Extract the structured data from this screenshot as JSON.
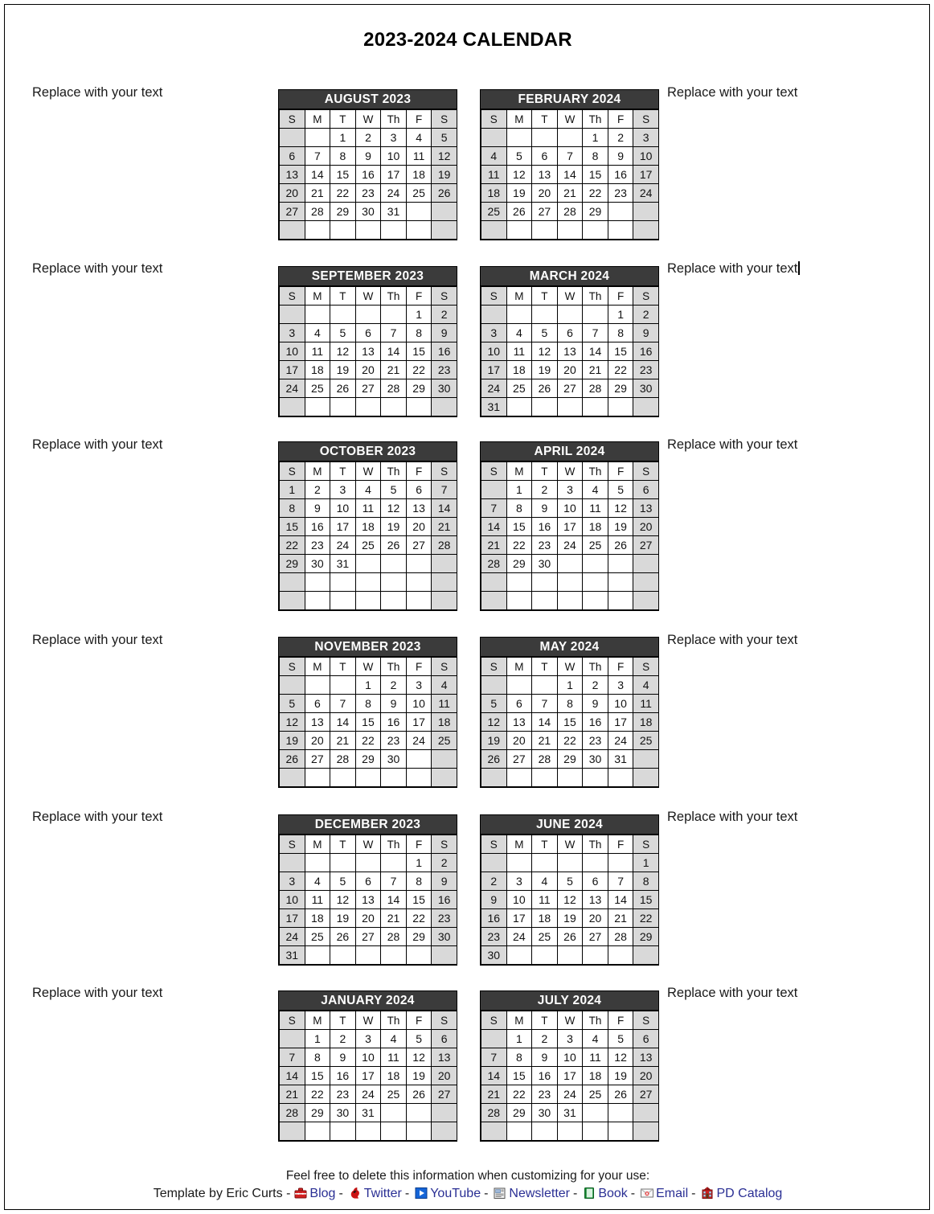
{
  "document": {
    "title": "2023-2024 CALENDAR"
  },
  "side_labels": {
    "default": "Replace with your text",
    "rows": [
      {
        "left": "Replace with your text",
        "right": "Replace with your text",
        "right_caret": false
      },
      {
        "left": "Replace with your text",
        "right": "Replace with your text",
        "right_caret": true
      },
      {
        "left": "Replace with your text",
        "right": "Replace with your text",
        "right_caret": false
      },
      {
        "left": "Replace with your text",
        "right": "Replace with your text",
        "right_caret": false
      },
      {
        "left": "Replace with your text",
        "right": "Replace with your text",
        "right_caret": false
      },
      {
        "left": "Replace with your text",
        "right": "Replace with your text",
        "right_caret": false
      }
    ]
  },
  "weekday_headers": [
    "S",
    "M",
    "T",
    "W",
    "Th",
    "F",
    "S"
  ],
  "colors": {
    "month_header_bg": "#3b3b3b",
    "month_header_text": "#ffffff",
    "weekend_cell_bg": "#d9d9d9",
    "cell_bg": "#ffffff",
    "grid_line": "#000000",
    "link": "#2a2f94",
    "page_border": "#000000"
  },
  "months": [
    {
      "name": "AUGUST 2023",
      "column": "left",
      "row": 0,
      "weeks": [
        [
          "",
          "",
          "1",
          "2",
          "3",
          "4",
          "5"
        ],
        [
          "6",
          "7",
          "8",
          "9",
          "10",
          "11",
          "12"
        ],
        [
          "13",
          "14",
          "15",
          "16",
          "17",
          "18",
          "19"
        ],
        [
          "20",
          "21",
          "22",
          "23",
          "24",
          "25",
          "26"
        ],
        [
          "27",
          "28",
          "29",
          "30",
          "31",
          "",
          ""
        ],
        [
          "",
          "",
          "",
          "",
          "",
          "",
          ""
        ]
      ]
    },
    {
      "name": "FEBRUARY 2024",
      "column": "right",
      "row": 0,
      "weeks": [
        [
          "",
          "",
          "",
          "",
          "1",
          "2",
          "3"
        ],
        [
          "4",
          "5",
          "6",
          "7",
          "8",
          "9",
          "10"
        ],
        [
          "11",
          "12",
          "13",
          "14",
          "15",
          "16",
          "17"
        ],
        [
          "18",
          "19",
          "20",
          "21",
          "22",
          "23",
          "24"
        ],
        [
          "25",
          "26",
          "27",
          "28",
          "29",
          "",
          ""
        ],
        [
          "",
          "",
          "",
          "",
          "",
          "",
          ""
        ]
      ]
    },
    {
      "name": "SEPTEMBER 2023",
      "column": "left",
      "row": 1,
      "weeks": [
        [
          "",
          "",
          "",
          "",
          "",
          "1",
          "2"
        ],
        [
          "3",
          "4",
          "5",
          "6",
          "7",
          "8",
          "9"
        ],
        [
          "10",
          "11",
          "12",
          "13",
          "14",
          "15",
          "16"
        ],
        [
          "17",
          "18",
          "19",
          "20",
          "21",
          "22",
          "23"
        ],
        [
          "24",
          "25",
          "26",
          "27",
          "28",
          "29",
          "30"
        ],
        [
          "",
          "",
          "",
          "",
          "",
          "",
          ""
        ]
      ]
    },
    {
      "name": "MARCH 2024",
      "column": "right",
      "row": 1,
      "weeks": [
        [
          "",
          "",
          "",
          "",
          "",
          "1",
          "2"
        ],
        [
          "3",
          "4",
          "5",
          "6",
          "7",
          "8",
          "9"
        ],
        [
          "10",
          "11",
          "12",
          "13",
          "14",
          "15",
          "16"
        ],
        [
          "17",
          "18",
          "19",
          "20",
          "21",
          "22",
          "23"
        ],
        [
          "24",
          "25",
          "26",
          "27",
          "28",
          "29",
          "30"
        ],
        [
          "31",
          "",
          "",
          "",
          "",
          "",
          ""
        ]
      ]
    },
    {
      "name": "OCTOBER 2023",
      "column": "left",
      "row": 2,
      "weeks": [
        [
          "1",
          "2",
          "3",
          "4",
          "5",
          "6",
          "7"
        ],
        [
          "8",
          "9",
          "10",
          "11",
          "12",
          "13",
          "14"
        ],
        [
          "15",
          "16",
          "17",
          "18",
          "19",
          "20",
          "21"
        ],
        [
          "22",
          "23",
          "24",
          "25",
          "26",
          "27",
          "28"
        ],
        [
          "29",
          "30",
          "31",
          "",
          "",
          "",
          ""
        ],
        [
          "",
          "",
          "",
          "",
          "",
          "",
          ""
        ],
        [
          "",
          "",
          "",
          "",
          "",
          "",
          ""
        ]
      ]
    },
    {
      "name": "APRIL 2024",
      "column": "right",
      "row": 2,
      "weeks": [
        [
          "",
          "1",
          "2",
          "3",
          "4",
          "5",
          "6"
        ],
        [
          "7",
          "8",
          "9",
          "10",
          "11",
          "12",
          "13"
        ],
        [
          "14",
          "15",
          "16",
          "17",
          "18",
          "19",
          "20"
        ],
        [
          "21",
          "22",
          "23",
          "24",
          "25",
          "26",
          "27"
        ],
        [
          "28",
          "29",
          "30",
          "",
          "",
          "",
          ""
        ],
        [
          "",
          "",
          "",
          "",
          "",
          "",
          ""
        ],
        [
          "",
          "",
          "",
          "",
          "",
          "",
          ""
        ]
      ]
    },
    {
      "name": "NOVEMBER 2023",
      "column": "left",
      "row": 3,
      "weeks": [
        [
          "",
          "",
          "",
          "1",
          "2",
          "3",
          "4"
        ],
        [
          "5",
          "6",
          "7",
          "8",
          "9",
          "10",
          "11"
        ],
        [
          "12",
          "13",
          "14",
          "15",
          "16",
          "17",
          "18"
        ],
        [
          "19",
          "20",
          "21",
          "22",
          "23",
          "24",
          "25"
        ],
        [
          "26",
          "27",
          "28",
          "29",
          "30",
          "",
          ""
        ],
        [
          "",
          "",
          "",
          "",
          "",
          "",
          ""
        ]
      ]
    },
    {
      "name": "MAY 2024",
      "column": "right",
      "row": 3,
      "weeks": [
        [
          "",
          "",
          "",
          "1",
          "2",
          "3",
          "4"
        ],
        [
          "5",
          "6",
          "7",
          "8",
          "9",
          "10",
          "11"
        ],
        [
          "12",
          "13",
          "14",
          "15",
          "16",
          "17",
          "18"
        ],
        [
          "19",
          "20",
          "21",
          "22",
          "23",
          "24",
          "25"
        ],
        [
          "26",
          "27",
          "28",
          "29",
          "30",
          "31",
          ""
        ],
        [
          "",
          "",
          "",
          "",
          "",
          "",
          ""
        ]
      ]
    },
    {
      "name": "DECEMBER 2023",
      "column": "left",
      "row": 4,
      "weeks": [
        [
          "",
          "",
          "",
          "",
          "",
          "1",
          "2"
        ],
        [
          "3",
          "4",
          "5",
          "6",
          "7",
          "8",
          "9"
        ],
        [
          "10",
          "11",
          "12",
          "13",
          "14",
          "15",
          "16"
        ],
        [
          "17",
          "18",
          "19",
          "20",
          "21",
          "22",
          "23"
        ],
        [
          "24",
          "25",
          "26",
          "27",
          "28",
          "29",
          "30"
        ],
        [
          "31",
          "",
          "",
          "",
          "",
          "",
          ""
        ]
      ]
    },
    {
      "name": "JUNE 2024",
      "column": "right",
      "row": 4,
      "weeks": [
        [
          "",
          "",
          "",
          "",
          "",
          "",
          "1"
        ],
        [
          "2",
          "3",
          "4",
          "5",
          "6",
          "7",
          "8"
        ],
        [
          "9",
          "10",
          "11",
          "12",
          "13",
          "14",
          "15"
        ],
        [
          "16",
          "17",
          "18",
          "19",
          "20",
          "21",
          "22"
        ],
        [
          "23",
          "24",
          "25",
          "26",
          "27",
          "28",
          "29"
        ],
        [
          "30",
          "",
          "",
          "",
          "",
          "",
          ""
        ]
      ]
    },
    {
      "name": "JANUARY 2024",
      "column": "left",
      "row": 5,
      "weeks": [
        [
          "",
          "1",
          "2",
          "3",
          "4",
          "5",
          "6"
        ],
        [
          "7",
          "8",
          "9",
          "10",
          "11",
          "12",
          "13"
        ],
        [
          "14",
          "15",
          "16",
          "17",
          "18",
          "19",
          "20"
        ],
        [
          "21",
          "22",
          "23",
          "24",
          "25",
          "26",
          "27"
        ],
        [
          "28",
          "29",
          "30",
          "31",
          "",
          "",
          ""
        ],
        [
          "",
          "",
          "",
          "",
          "",
          "",
          ""
        ]
      ]
    },
    {
      "name": "JULY 2024",
      "column": "right",
      "row": 5,
      "weeks": [
        [
          "",
          "1",
          "2",
          "3",
          "4",
          "5",
          "6"
        ],
        [
          "7",
          "8",
          "9",
          "10",
          "11",
          "12",
          "13"
        ],
        [
          "14",
          "15",
          "16",
          "17",
          "18",
          "19",
          "20"
        ],
        [
          "21",
          "22",
          "23",
          "24",
          "25",
          "26",
          "27"
        ],
        [
          "28",
          "29",
          "30",
          "31",
          "",
          "",
          ""
        ],
        [
          "",
          "",
          "",
          "",
          "",
          "",
          ""
        ]
      ]
    }
  ],
  "footer": {
    "note": "Feel free to delete this information when customizing for your use:",
    "attribution": "Template by Eric Curts -",
    "separator": "-",
    "links": [
      {
        "label": "Blog",
        "icon": "toolbox-icon"
      },
      {
        "label": "Twitter",
        "icon": "cardinal-bird-icon"
      },
      {
        "label": "YouTube",
        "icon": "play-button-icon"
      },
      {
        "label": "Newsletter",
        "icon": "newspaper-icon"
      },
      {
        "label": "Book",
        "icon": "book-icon"
      },
      {
        "label": "Email",
        "icon": "envelope-icon"
      },
      {
        "label": "PD Catalog",
        "icon": "school-building-icon"
      }
    ]
  }
}
